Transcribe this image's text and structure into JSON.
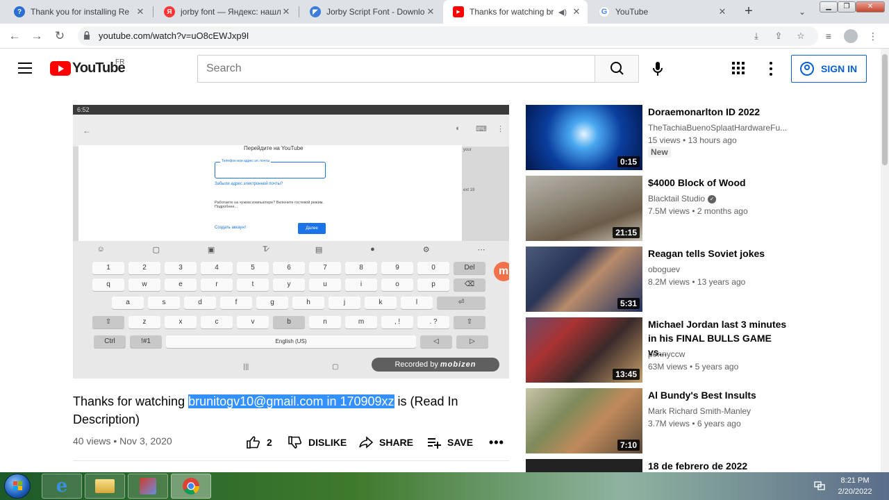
{
  "browser": {
    "tabs": [
      {
        "title": "Thank you for installing Re",
        "favicon_color": "#2a6ed1",
        "favicon_glyph": "?"
      },
      {
        "title": "jorby font — Яндекс: нашл",
        "favicon_color": "#f33",
        "favicon_glyph": "Я"
      },
      {
        "title": "Jorby Script Font - Downlo",
        "favicon_color": "#3c7ddc",
        "favicon_glyph": "◤"
      },
      {
        "title": "Thanks for watching br",
        "favicon_color": "#ff0000",
        "favicon_glyph": "▶",
        "active": true
      },
      {
        "title": "YouTube",
        "favicon_color": "#4285f4",
        "favicon_glyph": "G"
      }
    ],
    "url": "youtube.com/watch?v=uO8cEWJxp9I"
  },
  "header": {
    "logo_text": "YouTube",
    "country_code": "FR",
    "search_placeholder": "Search",
    "signin_label": "SIGN IN"
  },
  "player": {
    "status_time": "6:52",
    "page_title": "Перейдите на YouTube",
    "field_label": "Телефон или адрес эл. почты",
    "forgot_link": "Забыли адрес электронной почты?",
    "guest_text": "Работаете на чужом компьютере? Включите гостевой режим. Подробнее...",
    "create_account": "Создать аккаунт",
    "next_button": "Далее",
    "side_text_1": "your",
    "side_text_2": "ext 19",
    "space_label": "English (US)",
    "watermark_prefix": "Recorded by",
    "watermark_brand": "mobizen",
    "keyboard_rows": [
      [
        "1",
        "2",
        "3",
        "4",
        "5",
        "6",
        "7",
        "8",
        "9",
        "0",
        "Del"
      ],
      [
        "q",
        "w",
        "e",
        "r",
        "t",
        "y",
        "u",
        "i",
        "o",
        "p",
        "⌫"
      ],
      [
        "a",
        "s",
        "d",
        "f",
        "g",
        "h",
        "j",
        "k",
        "l",
        "⏎"
      ],
      [
        "⇧",
        "z",
        "x",
        "c",
        "v",
        "b",
        "n",
        "m",
        ", !",
        ". ?",
        "⇧"
      ]
    ],
    "bottom_row": [
      "Ctrl",
      "!#1",
      "English (US)",
      "◁",
      "▷"
    ]
  },
  "video": {
    "title_before": "Thanks for watching ",
    "title_selected": "brunitogv10@gmail.com in 170909xz",
    "title_after": " is (Read In Description)",
    "views": "40 views",
    "date": "Nov 3, 2020",
    "likes": "2",
    "dislike_label": "DISLIKE",
    "share_label": "SHARE",
    "save_label": "SAVE"
  },
  "related": [
    {
      "title": "Doraemonarlton ID 2022",
      "channel": "TheTachiaBuenoSplaatHardwareFu...",
      "views": "15 views",
      "age": "13 hours ago",
      "duration": "0:15",
      "badge": "New"
    },
    {
      "title": "$4000 Block of Wood",
      "channel": "Blacktail Studio",
      "verified": true,
      "views": "7.5M views",
      "age": "2 months ago",
      "duration": "21:15"
    },
    {
      "title": "Reagan tells Soviet jokes",
      "channel": "oboguev",
      "views": "8.2M views",
      "age": "13 years ago",
      "duration": "5:31"
    },
    {
      "title": "Michael Jordan last 3 minutes in his FINAL BULLS GAME vs...",
      "channel": "pennyccw",
      "views": "63M views",
      "age": "5 years ago",
      "duration": "13:45"
    },
    {
      "title": "Al Bundy's Best Insults",
      "channel": "Mark Richard Smith-Manley",
      "views": "3.7M views",
      "age": "6 years ago",
      "duration": "7:10"
    },
    {
      "title": "18 de febrero de 2022",
      "channel": "",
      "views": "",
      "age": "",
      "duration": ""
    }
  ],
  "taskbar": {
    "time": "8:21 PM",
    "date": "2/20/2022"
  }
}
